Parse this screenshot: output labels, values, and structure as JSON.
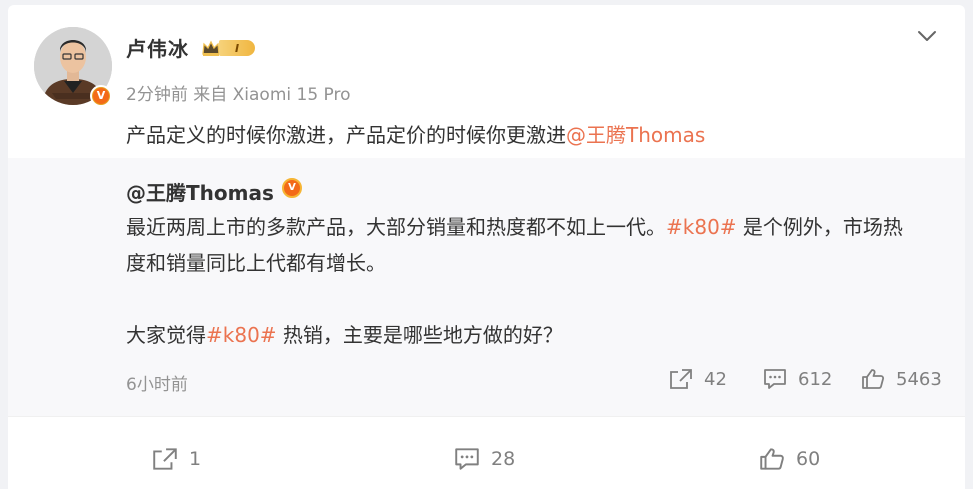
{
  "post": {
    "author": "卢伟冰",
    "level_badge": "I",
    "verified_mark": "V",
    "time": "2分钟前",
    "source": "来自 Xiaomi 15 Pro",
    "text_main": "产品定义的时候你激进，产品定价的时候你更激进",
    "text_mention": "@王腾Thomas"
  },
  "repost": {
    "author": "@王腾Thomas",
    "verified_mark": "V",
    "line1_a": "最近两周上市的多款产品，大部分销量和热度都不如上一代。",
    "line1_tag": "#k80#",
    "line1_b": " 是个例外，市场热",
    "line2": "度和销量同比上代都有增长。",
    "line3_a": "大家觉得",
    "line3_tag": "#k80#",
    "line3_b": " 热销，主要是哪些地方做的好？",
    "time": "6小时前",
    "share_count": "42",
    "comment_count": "612",
    "like_count": "5463"
  },
  "actions": {
    "share_count": "1",
    "comment_count": "28",
    "like_count": "60"
  },
  "icons": {
    "more": "chevron-down-icon",
    "share": "share-icon",
    "comment": "comment-icon",
    "like": "thumbs-up-icon"
  },
  "colors": {
    "link": "#eb7350",
    "muted": "#939393",
    "verified": "#f36a18"
  }
}
